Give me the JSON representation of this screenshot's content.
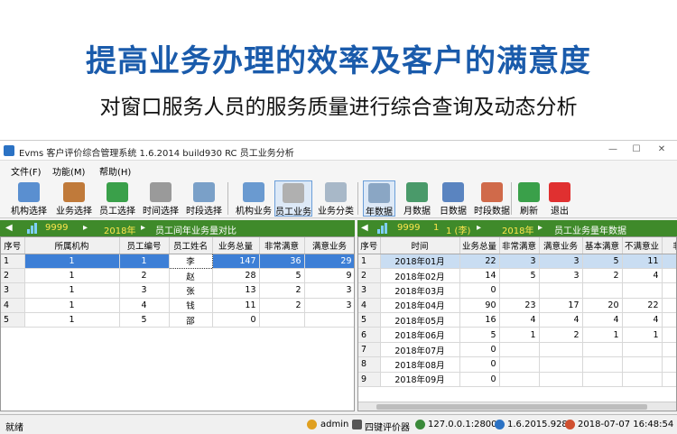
{
  "banner": {
    "headline": "提高业务办理的效率及客户的满意度",
    "subline": "对窗口服务人员的服务质量进行综合查询及动态分析"
  },
  "window": {
    "title": "Evms 客户评价综合管理系统 1.6.2014 build930 RC 员工业务分析",
    "controls": [
      "—",
      "☐",
      "✕"
    ]
  },
  "menu": [
    "文件(F)",
    "功能(M)",
    "帮助(H)"
  ],
  "toolbar": [
    {
      "label": "机构选择",
      "icon": "org-search-icon",
      "color": "#5a8fd0"
    },
    {
      "label": "业务选择",
      "icon": "book-icon",
      "color": "#c07a3a"
    },
    {
      "label": "员工选择",
      "icon": "staff-icon",
      "color": "#3aa04a"
    },
    {
      "label": "时间选择",
      "icon": "clock-icon",
      "color": "#9a9a9a"
    },
    {
      "label": "时段选择",
      "icon": "calendar-clock-icon",
      "color": "#7aa0c8"
    },
    {
      "label": "机构业务",
      "icon": "org-globe-icon",
      "color": "#6a9ad0"
    },
    {
      "label": "员工业务",
      "icon": "notepad-icon",
      "color": "#b0b0b0",
      "selected": true
    },
    {
      "label": "业务分类",
      "icon": "documents-icon",
      "color": "#a8b8c8"
    },
    {
      "label": "年数据",
      "icon": "year-grid-icon",
      "color": "#8aa6c4",
      "selected": true
    },
    {
      "label": "月数据",
      "icon": "month-grid-icon",
      "color": "#4a9a6a"
    },
    {
      "label": "日数据",
      "icon": "day-grid-icon",
      "color": "#5a84c0"
    },
    {
      "label": "时段数据",
      "icon": "period-grid-icon",
      "color": "#d06a4a"
    },
    {
      "label": "刷新",
      "icon": "refresh-icon",
      "color": "#3aa04a"
    },
    {
      "label": "退出",
      "icon": "exit-icon",
      "color": "#e03030"
    }
  ],
  "left_panel": {
    "code": "9999",
    "year": "2018年",
    "title": "员工间年业务量对比",
    "columns": [
      "序号",
      "所属机构",
      "员工编号",
      "员工姓名",
      "业务总量",
      "非常满意",
      "满意业务"
    ],
    "rows": [
      [
        "1",
        "1",
        "1",
        "李",
        "147",
        "36",
        "29"
      ],
      [
        "2",
        "1",
        "2",
        "赵",
        "28",
        "5",
        "9"
      ],
      [
        "3",
        "1",
        "3",
        "张",
        "13",
        "2",
        "3"
      ],
      [
        "4",
        "1",
        "4",
        "钱",
        "11",
        "2",
        "3"
      ],
      [
        "5",
        "1",
        "5",
        "邵",
        "0",
        "",
        ""
      ]
    ]
  },
  "right_panel": {
    "code": "9999",
    "mid": "1",
    "staff": "1 (李)",
    "year": "2018年",
    "title": "员工业务量年数据",
    "columns": [
      "序号",
      "时间",
      "业务总量",
      "非常满意",
      "满意业务",
      "基本满意",
      "不满意业",
      "非"
    ],
    "rows": [
      [
        "1",
        "2018年01月",
        "22",
        "3",
        "3",
        "5",
        "11"
      ],
      [
        "2",
        "2018年02月",
        "14",
        "5",
        "3",
        "2",
        "4"
      ],
      [
        "3",
        "2018年03月",
        "0",
        "",
        "",
        "",
        ""
      ],
      [
        "4",
        "2018年04月",
        "90",
        "23",
        "17",
        "20",
        "22"
      ],
      [
        "5",
        "2018年05月",
        "16",
        "4",
        "4",
        "4",
        "4"
      ],
      [
        "6",
        "2018年06月",
        "5",
        "1",
        "2",
        "1",
        "1"
      ],
      [
        "7",
        "2018年07月",
        "0",
        "",
        "",
        "",
        ""
      ],
      [
        "8",
        "2018年08月",
        "0",
        "",
        "",
        "",
        ""
      ],
      [
        "9",
        "2018年09月",
        "0",
        "",
        "",
        "",
        ""
      ]
    ]
  },
  "status": {
    "left": "就绪",
    "user": "admin",
    "device": "四键评价器",
    "server": "127.0.0.1:28000",
    "version": "1.6.2015.928",
    "datetime": "2018-07-07 16:48:54"
  }
}
